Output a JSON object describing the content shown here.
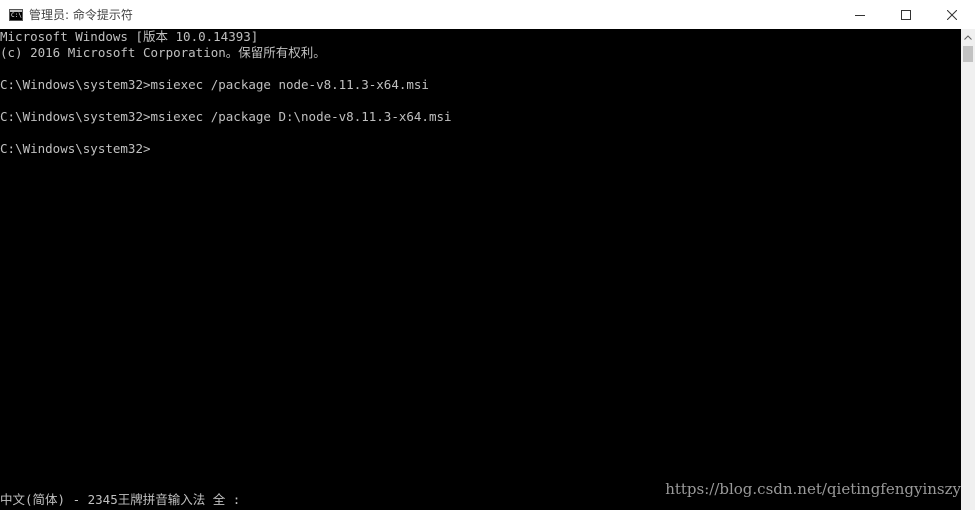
{
  "window": {
    "title": "管理员: 命令提示符",
    "icon": "cmd-app-icon",
    "icon_text": "C:\\."
  },
  "controls": {
    "minimize": "minimize-icon",
    "maximize": "maximize-icon",
    "close": "close-icon"
  },
  "console": {
    "lines": [
      "Microsoft Windows [版本 10.0.14393]",
      "(c) 2016 Microsoft Corporation。保留所有权利。",
      "",
      "C:\\Windows\\system32>msiexec /package node-v8.11.3-x64.msi",
      "",
      "C:\\Windows\\system32>msiexec /package D:\\node-v8.11.3-x64.msi",
      "",
      "C:\\Windows\\system32>"
    ],
    "ime_status": "中文(简体) - 2345王牌拼音输入法 全 :"
  },
  "watermark": "https://blog.csdn.net/qietingfengyinszy",
  "colors": {
    "background": "#000000",
    "text": "#c0c0c0",
    "titlebar": "#ffffff",
    "scrollbar": "#f0f0f0"
  }
}
